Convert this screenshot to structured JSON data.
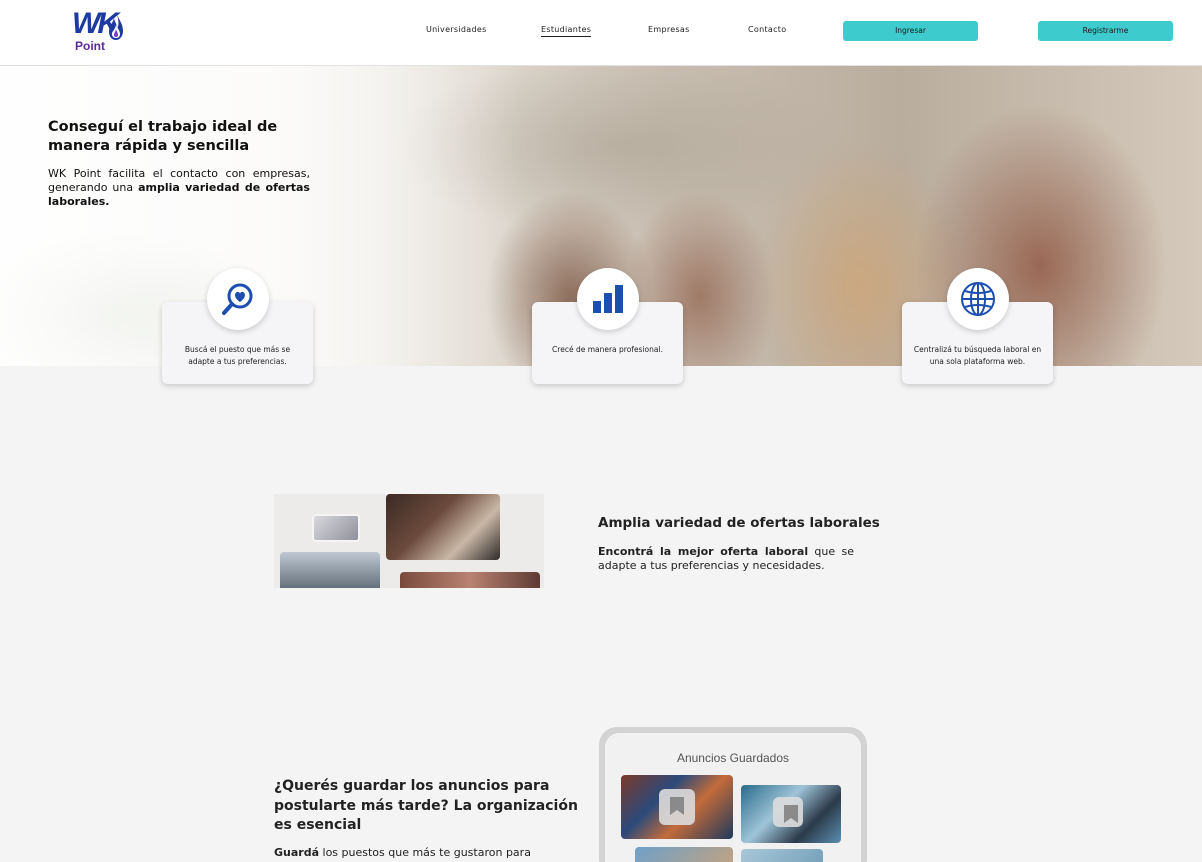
{
  "brand": {
    "logo_text": "WK",
    "logo_sub": "Point",
    "logo_color": "#1c3aa0",
    "sub_color": "#5b2a99"
  },
  "nav": {
    "items": [
      {
        "label": "Universidades"
      },
      {
        "label": "Estudiantes",
        "active": true
      },
      {
        "label": "Empresas"
      },
      {
        "label": "Contacto"
      }
    ],
    "login_label": "Ingresar",
    "register_label": "Registrarme",
    "button_color": "#3ecbcd"
  },
  "hero": {
    "title": "Conseguí el trabajo ideal de manera rápida y sencilla",
    "text_plain": "WK Point facilita el contacto con empresas, generando una ",
    "text_bold": "amplia variedad de ofertas laborales."
  },
  "features": [
    {
      "icon": "heart-search-icon",
      "text": "Buscá el puesto que más se adapte a tus preferencias."
    },
    {
      "icon": "bar-chart-icon",
      "text": "Crecé de manera profesional."
    },
    {
      "icon": "globe-icon",
      "text": "Centralizá tu búsqueda laboral en una sola plataforma web."
    }
  ],
  "section_offers": {
    "title": "Amplia variedad de ofertas laborales",
    "text_bold": "Encontrá la mejor oferta laboral",
    "text_plain": " que se adapte a tus preferencias y necesidades."
  },
  "section_saved": {
    "title": "¿Querés guardar los anuncios para postularte más tarde? La organización es esencial",
    "text_bold": "Guardá",
    "text_plain": " los puestos que más te gustaron para",
    "phone_title": "Anuncios Guardados"
  },
  "accent_icon_color": "#1c4fb0"
}
